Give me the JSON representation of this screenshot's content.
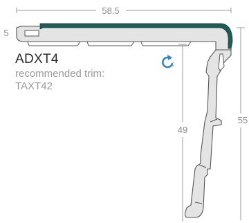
{
  "product": {
    "code": "ADXT4",
    "trim_label": "recommended trim:",
    "trim_code": "TAXT42"
  },
  "dimensions": {
    "width": "58.5",
    "left_height": "5",
    "inner_height": "49",
    "total_height": "55"
  },
  "icons": {
    "rotate": "rotate-arrow-icon"
  },
  "colors": {
    "insert": "#1f5b57",
    "profile_fill": "#e4e4e4",
    "profile_stroke": "#555555",
    "dimension_line": "#9a9a9a",
    "rotate_icon": "#2f86c8"
  }
}
